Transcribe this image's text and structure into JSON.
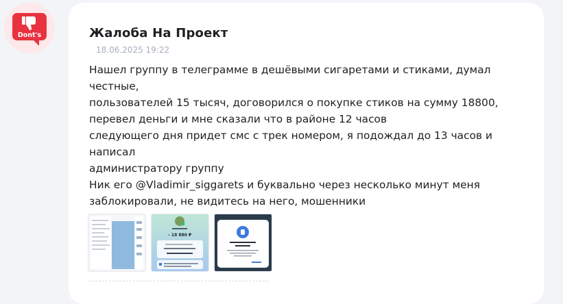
{
  "badge": {
    "label": "Dont's",
    "color": "#e8323f",
    "icon": "thumbs-down-icon"
  },
  "complaint": {
    "title": "Жалоба На Проект",
    "date": "18.06.2025 19:22",
    "text": "Нашел группу в телеграмме в дешёвыми сигаретами и стиками, думал честные,\nпользователей 15 тысяч, договорился о покупке стиков на сумму 18800,\nперевел деньги и мне сказали что в районе 12 часов\nследующего дня придет смс с трек номером, я подождал до 13 часов и написал\nадминистратору группу\nНик его @Vladimir_siggarets и буквально через несколько минут меня\nзаблокировали, не видитесь на него, мошенники"
  },
  "attachments": [
    {
      "name": "screenshot-chat"
    },
    {
      "name": "screenshot-payment",
      "amount": "– 18 880 ₽"
    },
    {
      "name": "screenshot-access-denied"
    }
  ]
}
